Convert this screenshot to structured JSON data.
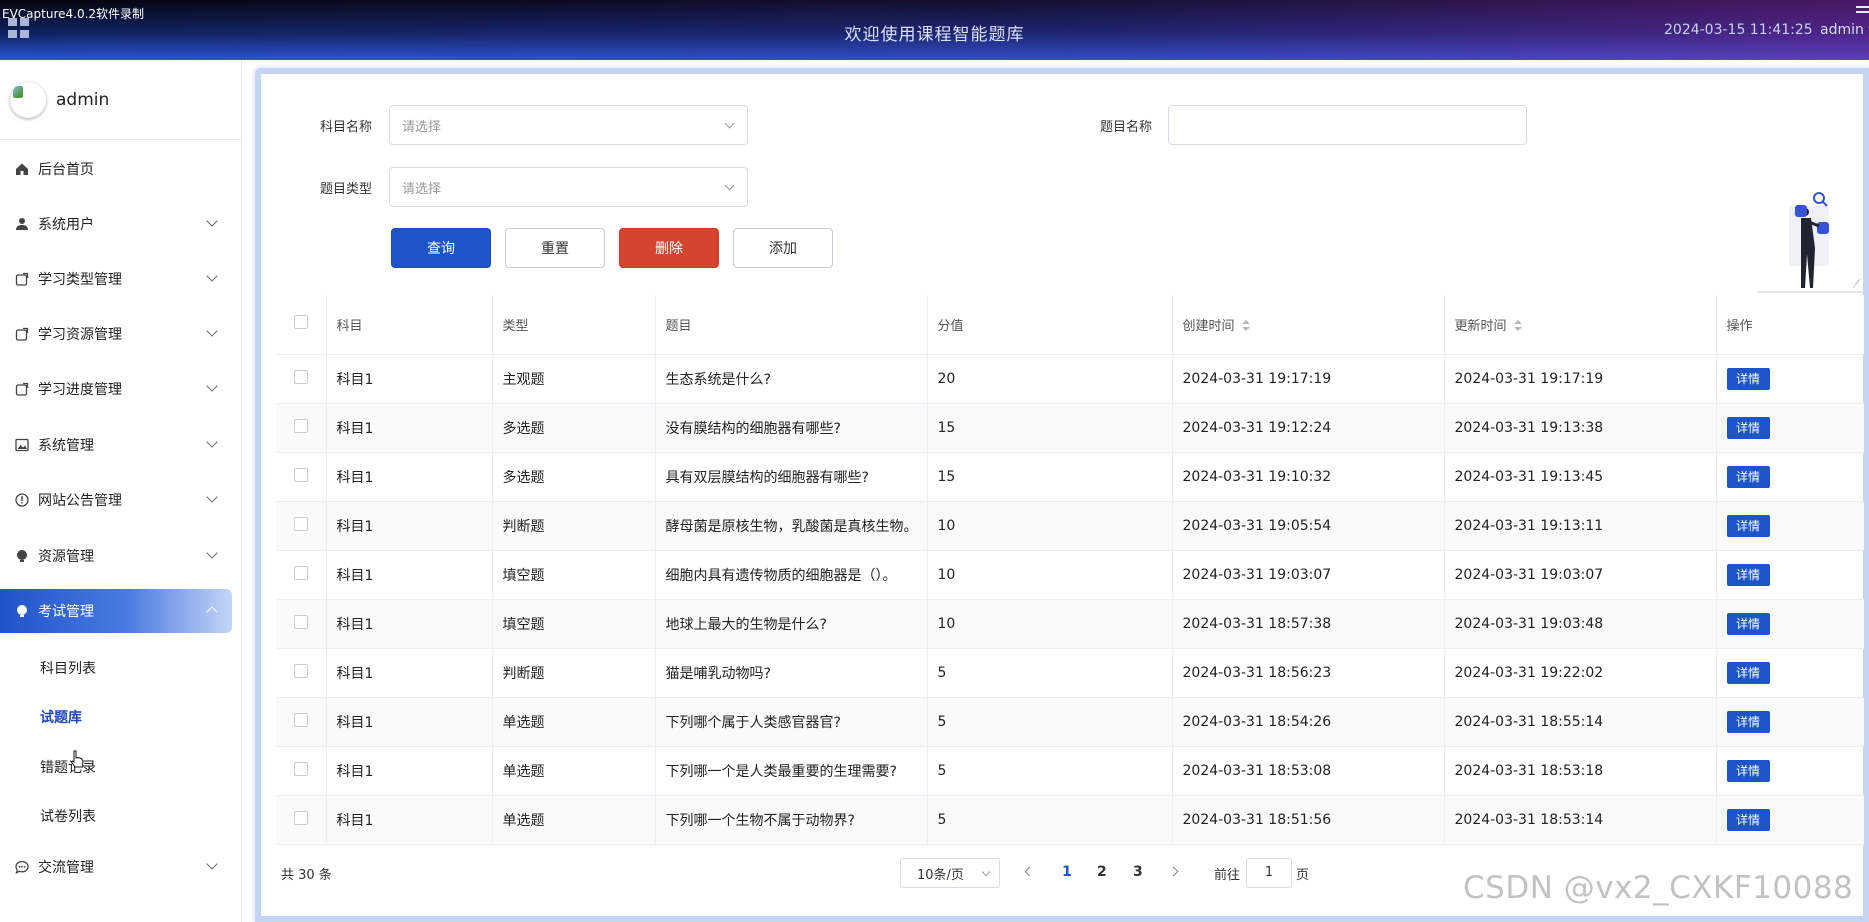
{
  "recorder_label": "EVCapture4.0.2软件录制",
  "header": {
    "title": "欢迎使用课程智能题库",
    "datetime": "2024-03-15 11:41:25",
    "user": "admin ▾"
  },
  "sidebar": {
    "username": "admin",
    "items": [
      {
        "label": "后台首页",
        "icon": "home-icon"
      },
      {
        "label": "系统用户",
        "icon": "user-icon"
      },
      {
        "label": "学习类型管理",
        "icon": "box-icon"
      },
      {
        "label": "学习资源管理",
        "icon": "box-icon"
      },
      {
        "label": "学习进度管理",
        "icon": "box-icon"
      },
      {
        "label": "系统管理",
        "icon": "image-icon"
      },
      {
        "label": "网站公告管理",
        "icon": "info-icon"
      },
      {
        "label": "资源管理",
        "icon": "bulb-icon"
      },
      {
        "label": "考试管理",
        "icon": "bulb-icon"
      },
      {
        "label": "交流管理",
        "icon": "chat-icon"
      }
    ],
    "sub_items": [
      "科目列表",
      "试题库",
      "错题记录",
      "试卷列表"
    ]
  },
  "filters": {
    "subject_label": "科目名称",
    "subject_placeholder": "请选择",
    "question_label": "题目名称",
    "type_label": "题目类型",
    "type_placeholder": "请选择"
  },
  "buttons": {
    "query": "查询",
    "reset": "重置",
    "delete": "删除",
    "add": "添加"
  },
  "table": {
    "columns": [
      "科目",
      "类型",
      "题目",
      "分值",
      "创建时间",
      "更新时间",
      "操作"
    ],
    "detail_label": "详情",
    "rows": [
      [
        "科目1",
        "主观题",
        "生态系统是什么?",
        "20",
        "2024-03-31 19:17:19",
        "2024-03-31 19:17:19"
      ],
      [
        "科目1",
        "多选题",
        "没有膜结构的细胞器有哪些?",
        "15",
        "2024-03-31 19:12:24",
        "2024-03-31 19:13:38"
      ],
      [
        "科目1",
        "多选题",
        "具有双层膜结构的细胞器有哪些?",
        "15",
        "2024-03-31 19:10:32",
        "2024-03-31 19:13:45"
      ],
      [
        "科目1",
        "判断题",
        "酵母菌是原核生物，乳酸菌是真核生物。",
        "10",
        "2024-03-31 19:05:54",
        "2024-03-31 19:13:11"
      ],
      [
        "科目1",
        "填空题",
        "细胞内具有遗传物质的细胞器是（）。",
        "10",
        "2024-03-31 19:03:07",
        "2024-03-31 19:03:07"
      ],
      [
        "科目1",
        "填空题",
        "地球上最大的生物是什么?",
        "10",
        "2024-03-31 18:57:38",
        "2024-03-31 19:03:48"
      ],
      [
        "科目1",
        "判断题",
        "猫是哺乳动物吗?",
        "5",
        "2024-03-31 18:56:23",
        "2024-03-31 19:22:02"
      ],
      [
        "科目1",
        "单选题",
        "下列哪个属于人类感官器官?",
        "5",
        "2024-03-31 18:54:26",
        "2024-03-31 18:55:14"
      ],
      [
        "科目1",
        "单选题",
        "下列哪一个是人类最重要的生理需要?",
        "5",
        "2024-03-31 18:53:08",
        "2024-03-31 18:53:18"
      ],
      [
        "科目1",
        "单选题",
        "下列哪一个生物不属于动物界?",
        "5",
        "2024-03-31 18:51:56",
        "2024-03-31 18:53:14"
      ]
    ]
  },
  "pagination": {
    "total": "共 30 条",
    "page_size": "10条/页",
    "pages": [
      "1",
      "2",
      "3"
    ],
    "current": "1",
    "goto_prefix": "前往",
    "goto_value": "1",
    "goto_suffix": "页"
  },
  "watermark": "CSDN @vx2_CXKF10088"
}
